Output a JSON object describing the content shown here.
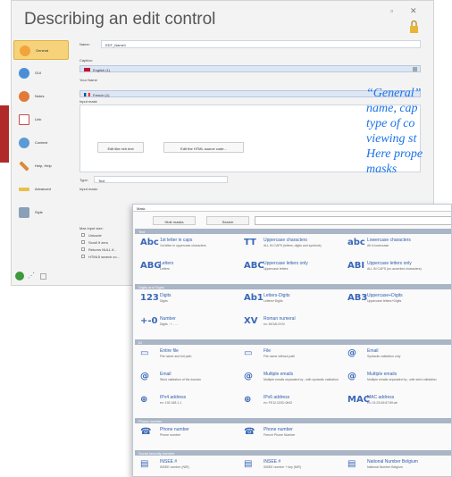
{
  "window": {
    "title": "Describing an edit control"
  },
  "sidebar": {
    "items": [
      {
        "label": "General",
        "color": "#f2a33a"
      },
      {
        "label": "GUI",
        "color": "#4a8fd6"
      },
      {
        "label": "Notes",
        "color": "#e27a3a"
      },
      {
        "label": "Link",
        "color": "#c94c4c"
      },
      {
        "label": "Content",
        "color": "#5a9bd6"
      },
      {
        "label": "Help, Help",
        "color": "#d98a3a"
      },
      {
        "label": "Advanced",
        "color": "#e8c04a"
      },
      {
        "label": "Style",
        "color": "#8aa0b8"
      }
    ]
  },
  "general": {
    "name_label": "Name:",
    "name_value": "EDT_Name1",
    "caption_label": "Caption:",
    "caption_lang": "English (1)",
    "tooltip_label": "Your Name",
    "tooltip_lang": "French (1)",
    "input_label": "Input mask",
    "edit_rich_btn": "Edit like rich text",
    "edit_html_btn": "Edit the HTML source code...",
    "type_label": "Type:",
    "type_value": "Text",
    "input_mask_label": "Input mask:",
    "max_input_label": "Max input size:",
    "checkboxes": [
      "Unicode",
      "Scroll if zero",
      "Returns NULL if...",
      "HTML5 search co..."
    ]
  },
  "panel": {
    "combo_value": "Mask",
    "tabs": [
      "Hide masks",
      "Search"
    ],
    "categories": [
      {
        "title": "Text",
        "items": [
          {
            "icon": "Abc",
            "name": "1st letter in caps",
            "desc": "1st letter in uppercase characters"
          },
          {
            "icon": "TT",
            "name": "Uppercase characters",
            "desc": "ALL IN CAPS (letters, digits and symbols)"
          },
          {
            "icon": "abc",
            "name": "Lowercase characters",
            "desc": "All in lowercase"
          },
          {
            "icon": "ABG",
            "name": "Letters",
            "desc": "Letters"
          },
          {
            "icon": "ABC",
            "name": "Uppercase letters only",
            "desc": "Uppercase letters"
          },
          {
            "icon": "ABI",
            "name": "Uppercase letters only",
            "desc": "ALL IN CAPS (no accented characters)"
          }
        ]
      },
      {
        "title": "Digits and Signs",
        "items": [
          {
            "icon": "123",
            "name": "Digits",
            "desc": "Digits"
          },
          {
            "icon": "Ab1",
            "name": "Letters-Digits",
            "desc": "Letters+Digits"
          },
          {
            "icon": "AB3",
            "name": "Uppercase+Digits",
            "desc": "Uppercase letters+Digits"
          },
          {
            "icon": "+-0",
            "name": "Number",
            "desc": "Digits , + - ..."
          },
          {
            "icon": "XV",
            "name": "Roman numeral",
            "desc": "ex: MCMLXXIV"
          }
        ]
      },
      {
        "title": "ID",
        "items": [
          {
            "icon": "▭",
            "name": "Entire file",
            "desc": "File name and full path"
          },
          {
            "icon": "▭",
            "name": "File",
            "desc": "File name without path"
          },
          {
            "icon": "@",
            "name": "Email",
            "desc": "Syntactic validation only"
          },
          {
            "icon": "@",
            "name": "Email",
            "desc": "Strict validation of the domain"
          },
          {
            "icon": "@",
            "name": "Multiple emails",
            "desc": "Multiple emails separated by ; with syntactic validation"
          },
          {
            "icon": "@",
            "name": "Multiple emails",
            "desc": "Multiple emails separated by ; with strict validation"
          },
          {
            "icon": "⊕",
            "name": "IPv4 address",
            "desc": "ex: 192.168.1.1"
          },
          {
            "icon": "⊕",
            "name": "IPv6 address",
            "desc": "ex: FE12:1153::0b02"
          },
          {
            "icon": "MAC",
            "name": "MAC address",
            "desc": "ex: 01:23:45:67:89:ab"
          }
        ]
      },
      {
        "title": "Phone number",
        "items": [
          {
            "icon": "☎",
            "name": "Phone number",
            "desc": "Phone number"
          },
          {
            "icon": "☎",
            "name": "Phone number",
            "desc": "French Phone Number"
          }
        ]
      },
      {
        "title": "Social security number",
        "items": [
          {
            "icon": "▤",
            "name": "INSEE #",
            "desc": "INSEE number (NIR)"
          },
          {
            "icon": "▤",
            "name": "INSEE #",
            "desc": "INSEE number + key (NIR)"
          },
          {
            "icon": "▤",
            "name": "National Number Belgium",
            "desc": "National Number Belgium"
          }
        ]
      }
    ]
  },
  "caption": {
    "lines": [
      "“General”",
      "name, cap",
      "type of co",
      "viewing st",
      "Here prope",
      "masks"
    ]
  },
  "colors": {
    "accent": "#f6d27a",
    "link": "#2f5eaa",
    "caption": "#1a73e8",
    "red_tab": "#b02a2a"
  }
}
